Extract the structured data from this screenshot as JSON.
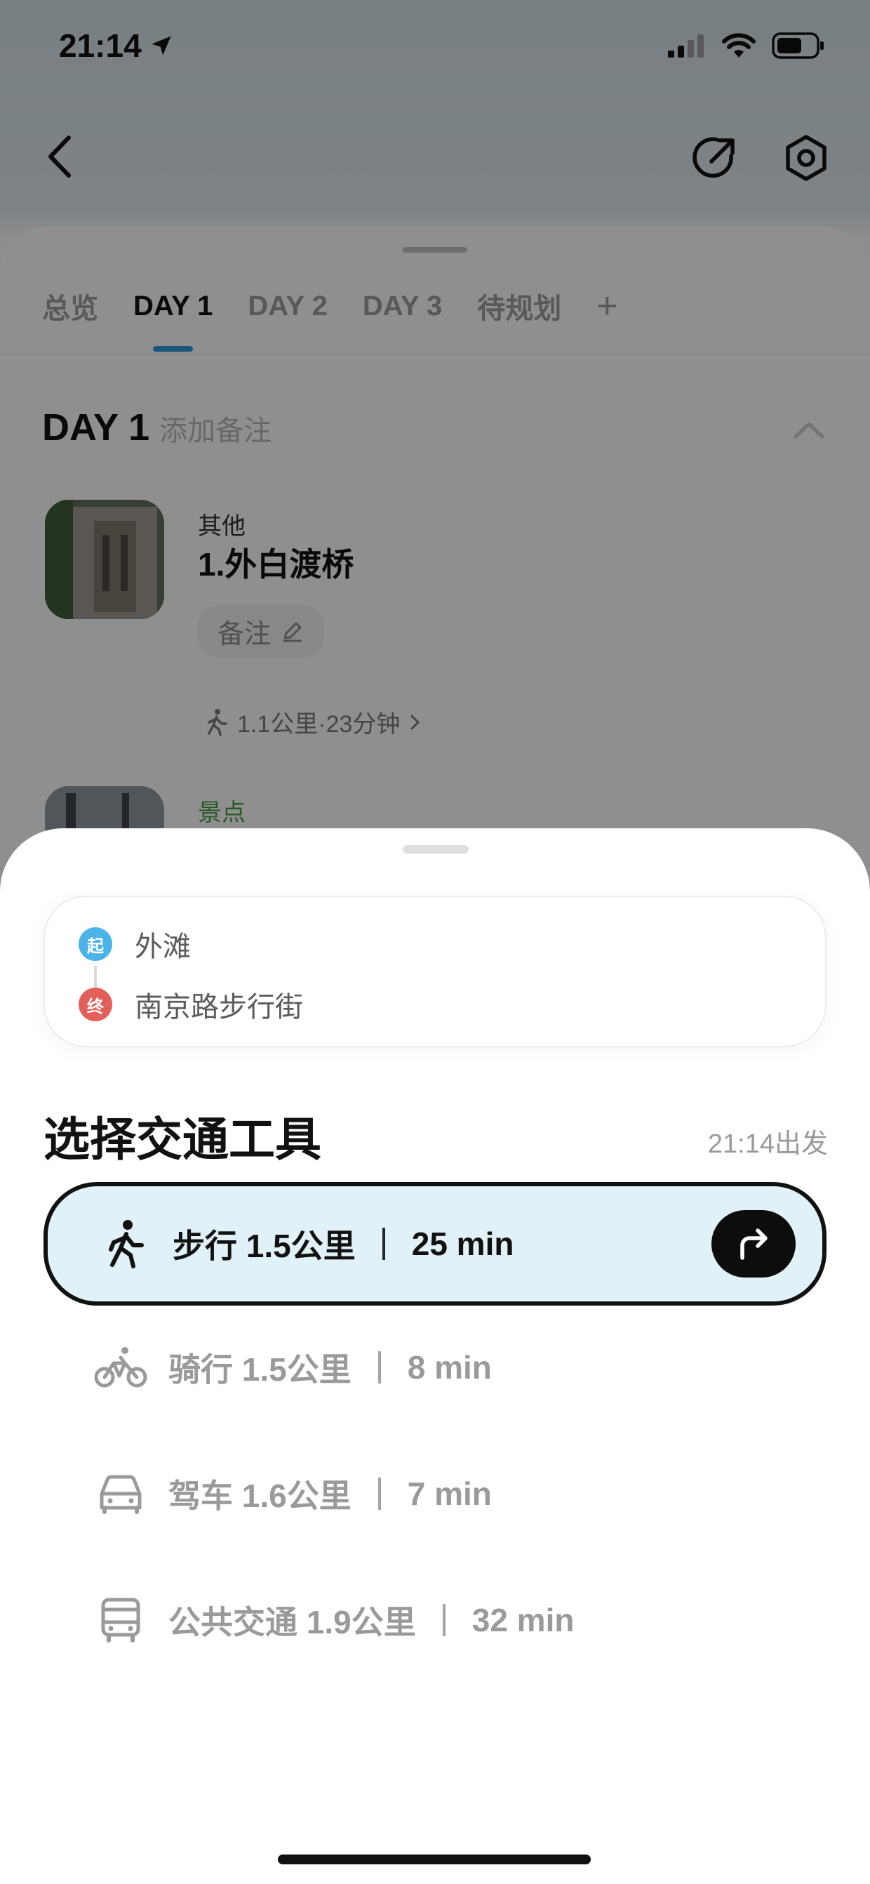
{
  "status_bar": {
    "time": "21:14"
  },
  "tabs": [
    {
      "label": "总览",
      "active": false
    },
    {
      "label": "DAY 1",
      "active": true
    },
    {
      "label": "DAY 2",
      "active": false
    },
    {
      "label": "DAY 3",
      "active": false
    },
    {
      "label": "待规划",
      "active": false
    }
  ],
  "tab_add": "+",
  "day": {
    "title": "DAY 1",
    "note_placeholder": "添加备注"
  },
  "pois": [
    {
      "category": "其他",
      "name": "1.外白渡桥",
      "note": "备注"
    },
    {
      "category": "景点",
      "name": ""
    }
  ],
  "route_chip": "1.1公里·23分钟",
  "sheet": {
    "start_badge": "起",
    "start_label": "外滩",
    "end_badge": "终",
    "end_label": "南京路步行街",
    "title": "选择交通工具",
    "depart": "21:14出发",
    "modes": [
      {
        "name": "步行 1.5公里",
        "time": "25 min",
        "icon": "walk-icon",
        "selected": true
      },
      {
        "name": "骑行 1.5公里",
        "time": "8 min",
        "icon": "bike-icon",
        "selected": false
      },
      {
        "name": "驾车 1.6公里",
        "time": "7 min",
        "icon": "car-icon",
        "selected": false
      },
      {
        "name": "公共交通 1.9公里",
        "time": "32 min",
        "icon": "bus-icon",
        "selected": false
      }
    ]
  },
  "colors": {
    "accent": "#2d95d6",
    "selected_bg": "#e1f1f8",
    "start": "#4cb3e8",
    "end": "#e25f5a",
    "category_green": "#4a9a4a"
  }
}
